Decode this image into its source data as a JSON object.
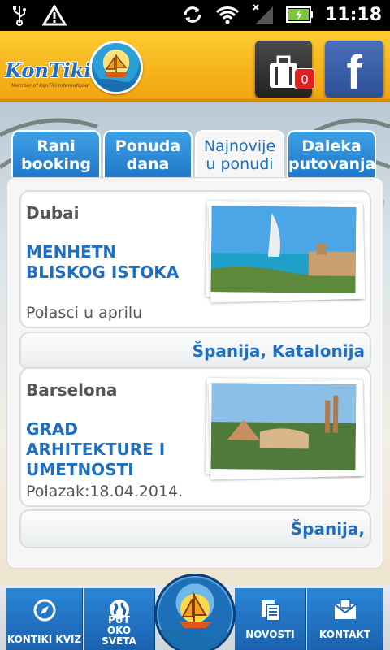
{
  "status_bar": {
    "time": "11:18"
  },
  "header": {
    "logo_text": "KonTiki",
    "logo_subtitle": "Member of KonTiki International",
    "cart_count": "0",
    "facebook_label": "f"
  },
  "tabs": [
    {
      "label": "Rani booking",
      "active": false
    },
    {
      "label": "Ponuda dana",
      "active": false
    },
    {
      "label": "Najnovije u ponudi",
      "active": true
    },
    {
      "label": "Daleka putovanja",
      "active": false
    }
  ],
  "offers": [
    {
      "city": "Dubai",
      "title": "MENHETN BLISKOG ISTOKA",
      "date": "Polasci u aprilu"
    },
    {
      "region": "Španija, Katalonija",
      "city": "Barselona",
      "title": "GRAD ARHITEKTURE I UMETNOSTI",
      "date": "Polazak:18.04.2014."
    },
    {
      "region": "Španija,"
    }
  ],
  "bottom_nav": [
    {
      "label": "KONTIKI KVIZ",
      "icon": "compass-icon"
    },
    {
      "label": "PUT OKO SVETA",
      "icon": "globe-icon"
    },
    {
      "label": "NOVOSTI",
      "icon": "news-icon"
    },
    {
      "label": "KONTAKT",
      "icon": "mail-icon"
    }
  ]
}
